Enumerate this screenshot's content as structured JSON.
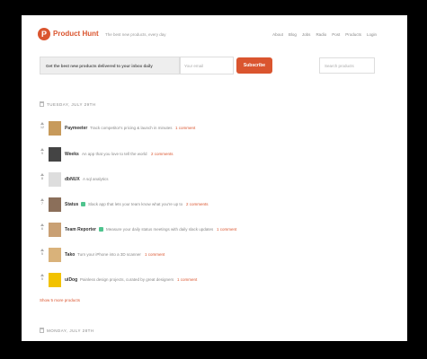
{
  "header": {
    "logo_mark": "P",
    "logo_text": "Product Hunt",
    "tagline": "The best new products, every day",
    "nav": [
      "About",
      "Blog",
      "Jobs",
      "Radio",
      "Post",
      "Products",
      "Login"
    ]
  },
  "subscribe": {
    "text": "Get the best new products delivered to your inbox daily",
    "email_placeholder": "Your email",
    "button_label": "Subscribe"
  },
  "search": {
    "placeholder": "Search products"
  },
  "days": [
    {
      "label": "TUESDAY, JULY 29TH",
      "posts": [
        {
          "votes": "12",
          "title": "Paymeeter",
          "tagline": "Track competitor's pricing & launch in minutes",
          "comments": "1 comment",
          "thumb": "#c79a5b"
        },
        {
          "votes": "9",
          "title": "Weeks",
          "tagline": "An app that you love to tell the world",
          "comments": "2 comments",
          "thumb": "#444444"
        },
        {
          "votes": "8",
          "title": "dbNUX",
          "tagline": "A sql analytics",
          "comments": "",
          "thumb": "#dddddd"
        },
        {
          "votes": "7",
          "title": "Status",
          "tagline": "Slack app that lets your team know what you're up to",
          "comments": "2 comments",
          "thumb": "#8b6f5a",
          "badge": true
        },
        {
          "votes": "6",
          "title": "Team Reporter",
          "tagline": "Measure your daily status meetings with daily slack updates",
          "comments": "1 comment",
          "thumb": "#c9a074",
          "badge": true
        },
        {
          "votes": "5",
          "title": "Tako",
          "tagline": "Turn your iPhone into a 3D scanner",
          "comments": "1 comment",
          "thumb": "#d9b27a"
        },
        {
          "votes": "5",
          "title": "uiDog",
          "tagline": "Painless design projects, curated by great designers",
          "comments": "1 comment",
          "thumb": "#f2c200"
        }
      ],
      "show_more": "Show 5 more products"
    },
    {
      "label": "MONDAY, JULY 28TH"
    }
  ],
  "colors": {
    "accent": "#da552f",
    "badge": "#4fc48e"
  }
}
